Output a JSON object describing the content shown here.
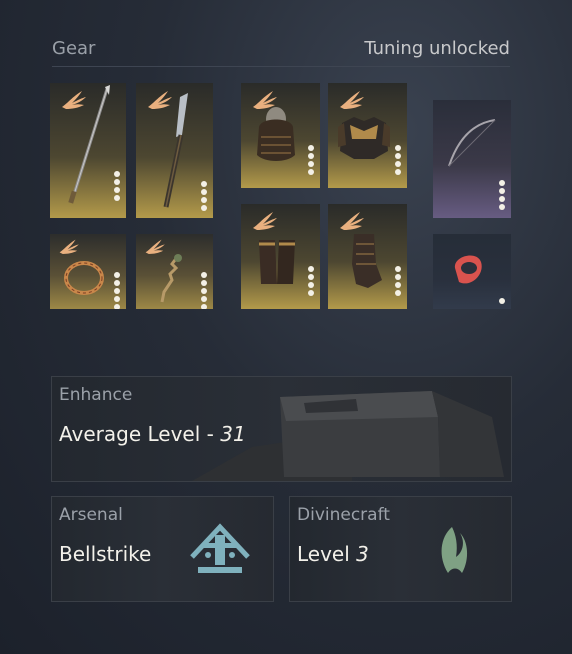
{
  "header": {
    "title": "Gear",
    "status": "Tuning unlocked"
  },
  "gear_slots": [
    {
      "name": "spear",
      "pips": 4
    },
    {
      "name": "glaive",
      "pips": 4
    },
    {
      "name": "helmet",
      "pips": 4
    },
    {
      "name": "chest-armor",
      "pips": 4
    },
    {
      "name": "bow",
      "pips": 4
    },
    {
      "name": "bracelet",
      "pips": 5
    },
    {
      "name": "pendant",
      "pips": 5
    },
    {
      "name": "bracers",
      "pips": 4
    },
    {
      "name": "greaves",
      "pips": 4
    },
    {
      "name": "ring",
      "pips": 1
    }
  ],
  "enhance": {
    "label": "Enhance",
    "value_prefix": "Average Level - ",
    "value": "31"
  },
  "arsenal": {
    "label": "Arsenal",
    "value": "Bellstrike",
    "icon": "bellstrike-emblem-icon"
  },
  "divinecraft": {
    "label": "Divinecraft",
    "value_prefix": "Level ",
    "value": "3",
    "icon": "divinecraft-emblem-icon"
  },
  "colors": {
    "gold": "#b39a4a",
    "purple": "#675c82",
    "teal": "#7fb1bd",
    "green": "#7fa184"
  }
}
